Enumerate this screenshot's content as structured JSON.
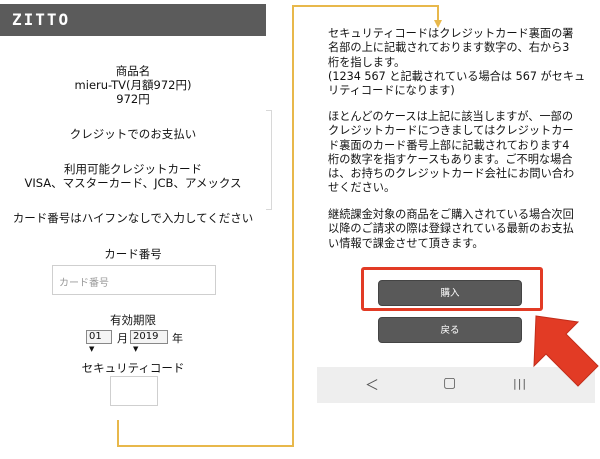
{
  "brand": "ZITTO",
  "product": {
    "label": "商品名",
    "name": "mieru-TV(月額972円)",
    "price": "972円"
  },
  "payment": {
    "method": "クレジットでのお支払い",
    "available_label": "利用可能クレジットカード",
    "available_cards": "VISA、マスターカード、JCB、アメックス",
    "instruction": "カード番号はハイフンなしで入力してください"
  },
  "form": {
    "card_number_label": "カード番号",
    "card_number_placeholder": "カード番号",
    "expiry_label": "有効期限",
    "month_value": "01",
    "month_unit": "月",
    "year_value": "2019",
    "year_unit": "年",
    "security_label": "セキュリティコード"
  },
  "info": {
    "para1_lines": [
      "セキュリティコードはクレジットカード裏面の署",
      "名部の上に記載されております数字の、右から3",
      "桁を指します。",
      "(1234 567 と記載されている場合は 567 がセキュ",
      "リティコードになります)"
    ],
    "para2_lines": [
      "ほとんどのケースは上記に該当しますが、一部の",
      "クレジットカードにつきましてはクレジットカー",
      "ド裏面のカード番号上部に記載されております4",
      "桁の数字を指すケースもあります。ご不明な場合",
      "は、お持ちのクレジットカード会社にお問い合わ",
      "せください。"
    ],
    "para3_lines": [
      "継続課金対象の商品をご購入されている場合次回",
      "以降のご請求の際は登録されている最新のお支払",
      "い情報で課金させて頂きます。"
    ]
  },
  "actions": {
    "purchase_label": "購入",
    "back_label": "戻る"
  },
  "nav": {
    "back_glyph": "＜",
    "home_glyph": "▢",
    "recents_glyph": "|||"
  },
  "colors": {
    "brand_bar": "#5b5b5b",
    "button": "#595959",
    "highlight": "#e23b25",
    "connector": "#e8b84b"
  }
}
